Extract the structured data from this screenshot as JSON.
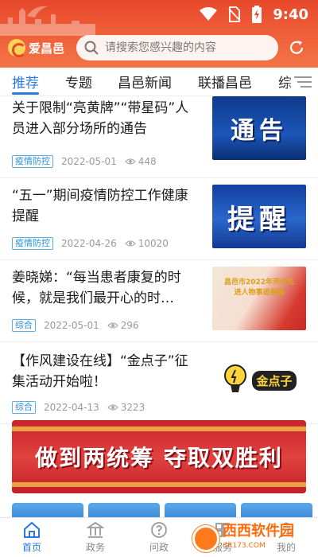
{
  "status_bar": {
    "time": "9:40",
    "icons": [
      "wifi-icon",
      "no-sim-icon",
      "battery-charging-icon"
    ]
  },
  "header": {
    "logo_text": "爱昌邑",
    "search_placeholder": "请搜索您感兴趣的内容",
    "refresh_icon": "refresh-icon",
    "accent_color": "#e8482b"
  },
  "tabs": [
    {
      "label": "推荐",
      "active": true
    },
    {
      "label": "专题"
    },
    {
      "label": "昌邑新闻"
    },
    {
      "label": "联播昌邑"
    },
    {
      "label": "综"
    }
  ],
  "news": [
    {
      "title": "关于限制“亮黄牌”“带星码”人员进入部分场所的通告",
      "tag": "疫情防控",
      "date": "2022-05-01",
      "views": "448",
      "thumb_text": "通告"
    },
    {
      "title": "“五一”期间疫情防控工作健康提醒",
      "tag": "疫情防控",
      "date": "2022-04-26",
      "views": "10020",
      "thumb_text": "提醒"
    },
    {
      "title": "姜晓娣：“每当患者康复的时候，就是我们最开心的时…",
      "tag": "综合",
      "date": "2022-05-01",
      "views": "296",
      "thumb_text": "昌邑市2022年劳动先进人物事迹展播"
    },
    {
      "title": "【作风建设在线】“金点子”征集活动开始啦！",
      "tag": "综合",
      "date": "2022-04-13",
      "views": "3223",
      "thumb_text": "金点子"
    }
  ],
  "banner": {
    "text": "做到两统筹  夺取双胜利"
  },
  "bottom_nav": [
    {
      "label": "首页",
      "icon": "home-icon",
      "active": true
    },
    {
      "label": "政务",
      "icon": "government-icon"
    },
    {
      "label": "问政",
      "icon": "question-icon"
    },
    {
      "label": "服务",
      "icon": "service-icon"
    },
    {
      "label": "我的",
      "icon": "profile-icon"
    }
  ],
  "watermark": {
    "text": "西西软件园",
    "sub": "CR173.COM"
  }
}
